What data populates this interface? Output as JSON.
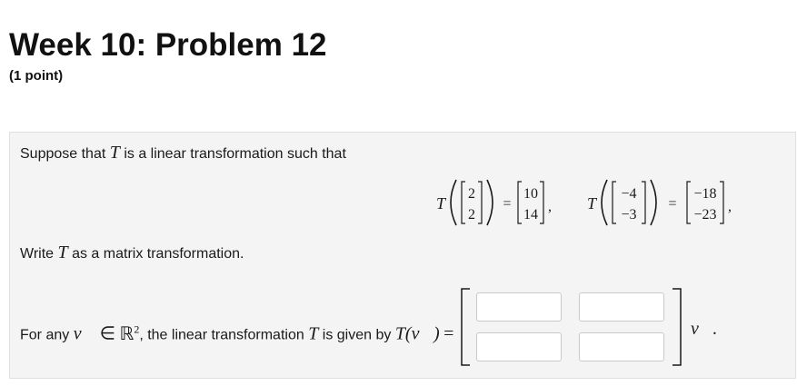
{
  "header": {
    "title": "Week 10: Problem 12",
    "points": "(1 point)"
  },
  "problem": {
    "intro_prefix": "Suppose that",
    "intro_var": "T",
    "intro_suffix": "is a linear transformation such that",
    "equation": {
      "map_symbol": "T",
      "first": {
        "input_top": "2",
        "input_bottom": "2",
        "output_top": "10",
        "output_bottom": "14"
      },
      "second": {
        "input_top": "−4",
        "input_bottom": "−3",
        "output_top": "−18",
        "output_bottom": "−23"
      },
      "equals": "=",
      "comma": ","
    },
    "instruction_prefix": "Write",
    "instruction_var": "T",
    "instruction_suffix": "as a matrix transformation.",
    "answer_line": {
      "prefix": "For any",
      "vec_symbol": "v⃗",
      "element_of": "∈",
      "space_symbol": "ℝ",
      "space_exp": "2",
      "middle": ", the linear transformation",
      "var": "T",
      "suffix": "is given by",
      "t_of_v": "T(v⃗)",
      "equals": "=",
      "trailing": "v⃗."
    },
    "matrix_inputs": [
      {
        "value": "",
        "placeholder": ""
      },
      {
        "value": "",
        "placeholder": ""
      },
      {
        "value": "",
        "placeholder": ""
      },
      {
        "value": "",
        "placeholder": ""
      }
    ]
  }
}
